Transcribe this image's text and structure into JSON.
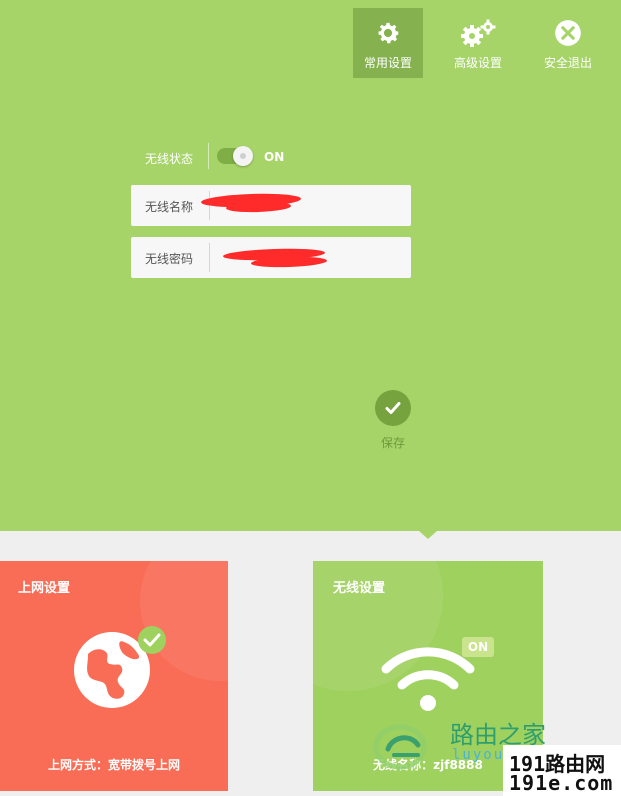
{
  "nav": {
    "items": [
      {
        "label": "常用设置",
        "icon": "gear-icon",
        "active": true
      },
      {
        "label": "高级设置",
        "icon": "gears-icon",
        "active": false
      },
      {
        "label": "安全退出",
        "icon": "close-circle-icon",
        "active": false
      }
    ]
  },
  "wireless_form": {
    "status_label": "无线状态",
    "status_value": "ON",
    "ssid_label": "无线名称",
    "ssid_value": "",
    "password_label": "无线密码",
    "password_value": "",
    "save_label": "保存"
  },
  "cards": {
    "internet": {
      "title": "上网设置",
      "subtitle": "上网方式：宽带拨号上网",
      "icon": "globe-icon",
      "status_icon": "check-icon"
    },
    "wireless": {
      "title": "无线设置",
      "subtitle": "无线名称：zjf8888",
      "badge": "ON",
      "icon": "wifi-icon"
    }
  },
  "watermarks": {
    "brand": "路由之家",
    "brand_url": "luyouqi.com",
    "site_line1": "191路由网",
    "site_line2": "191e.com"
  },
  "colors": {
    "header_green": "#a6d468",
    "active_nav": "#85b24e",
    "internet_card": "#f96c55",
    "wireless_card": "#9fd15f",
    "save_button": "#76a33e"
  }
}
